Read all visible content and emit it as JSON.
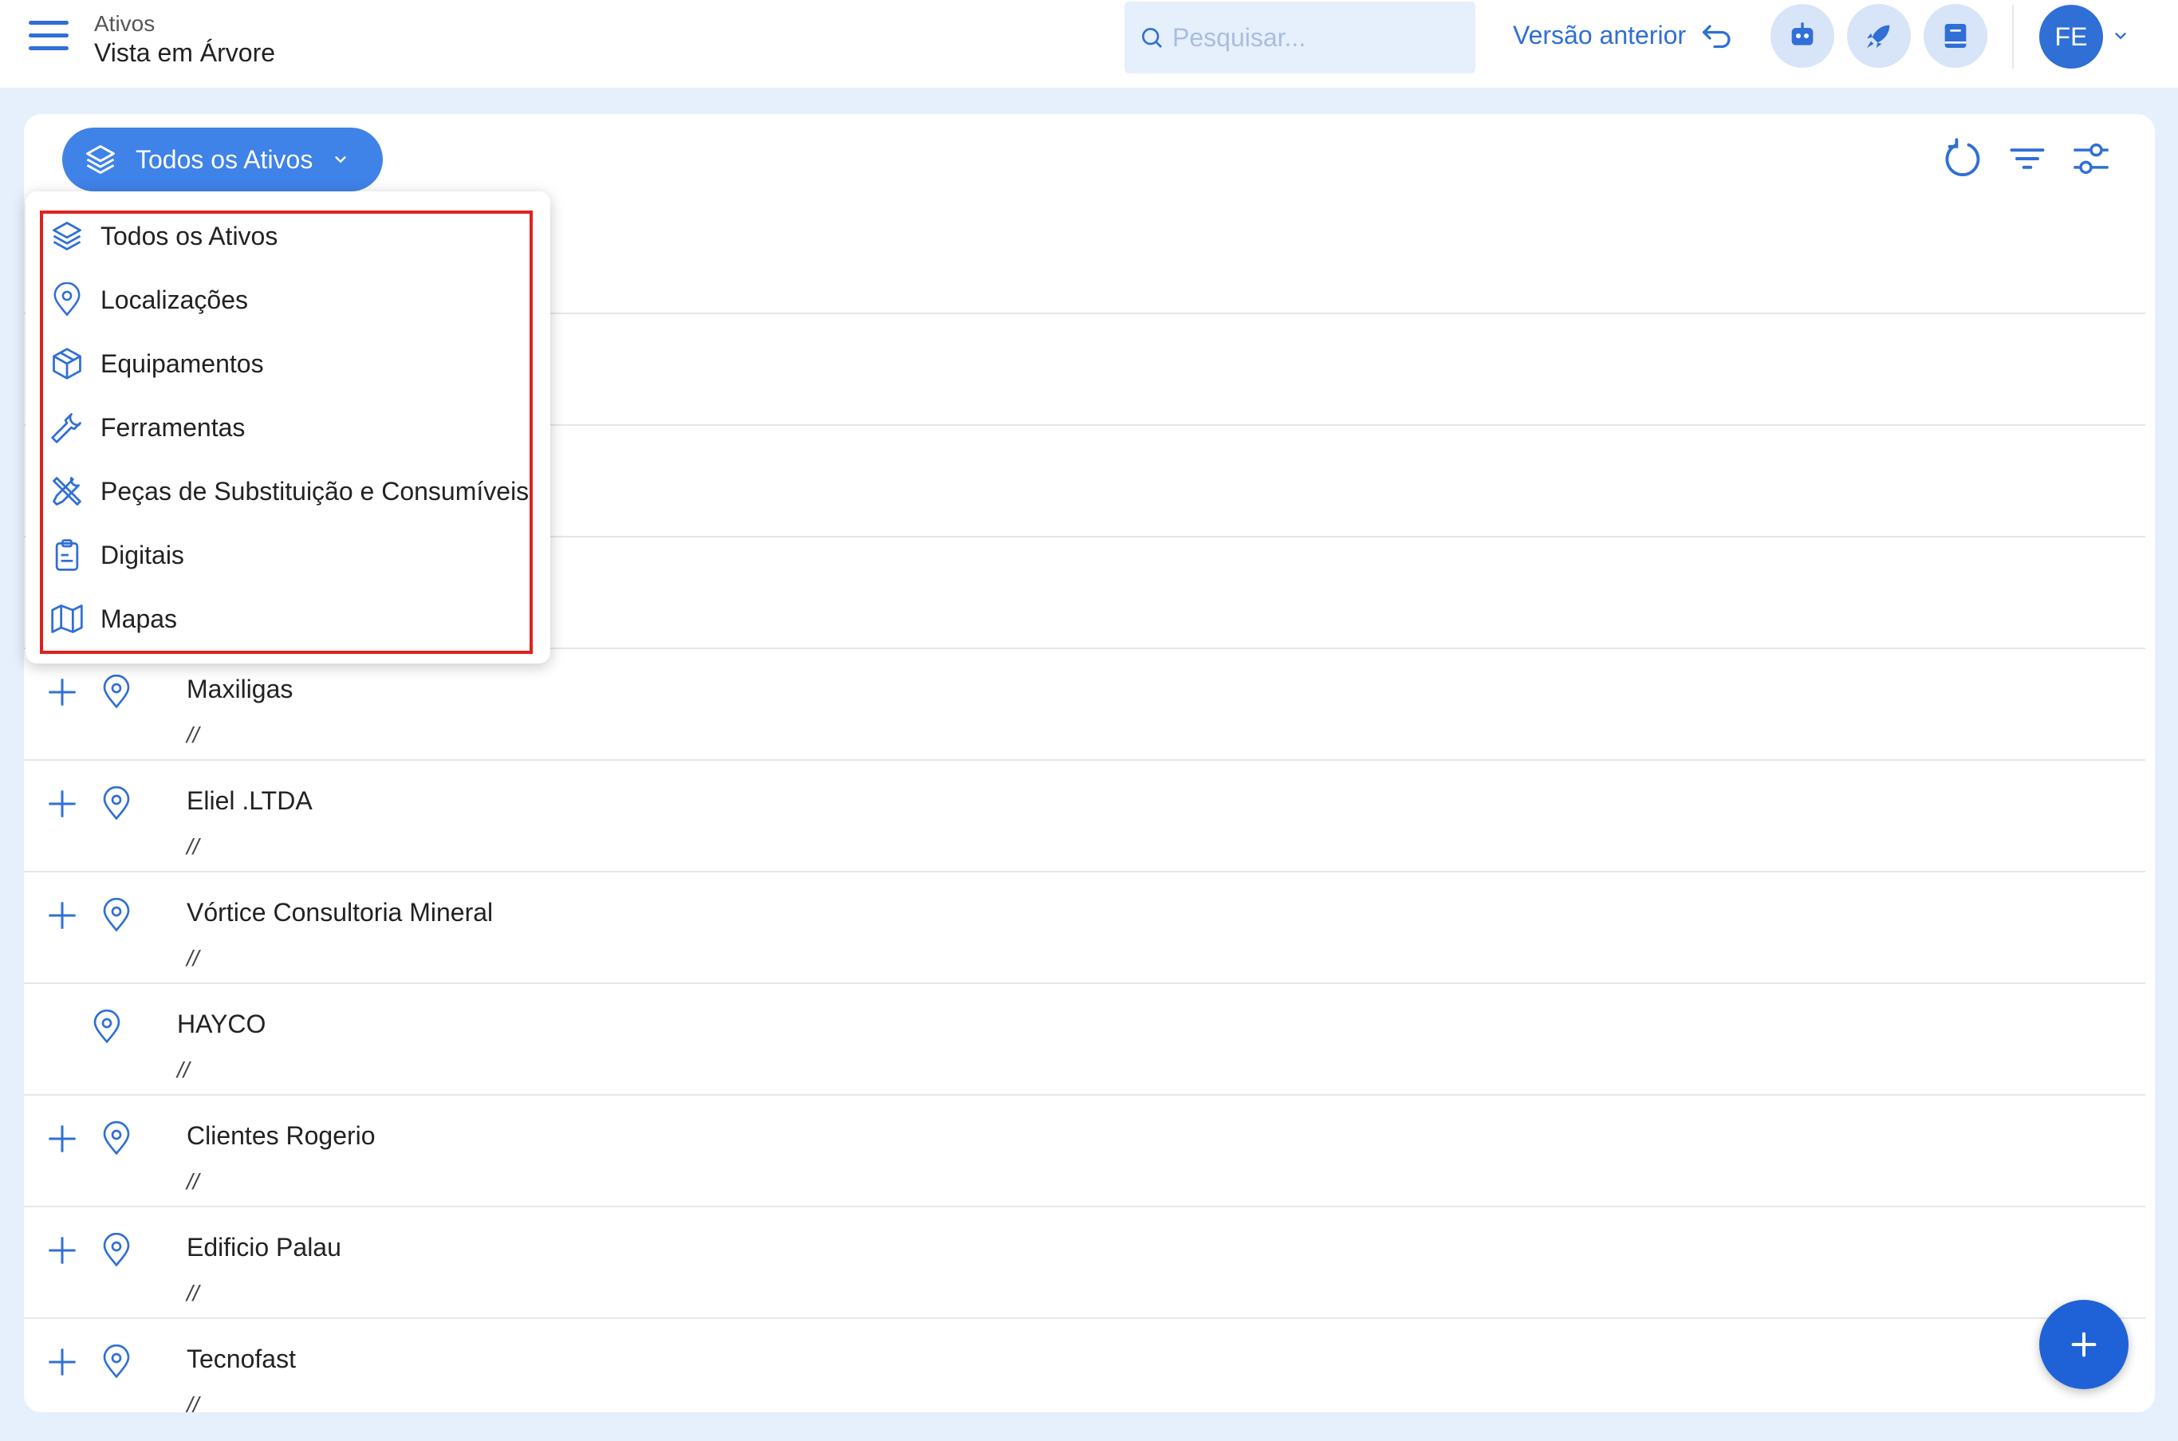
{
  "header": {
    "breadcrumb_parent": "Ativos",
    "page_title": "Vista em Árvore",
    "search_placeholder": "Pesquisar...",
    "previous_version_label": "Versão anterior",
    "user_initials": "FE",
    "icons": [
      "menu-icon",
      "search-icon",
      "undo-arrow-icon",
      "robot-icon",
      "rocket-icon",
      "book-icon",
      "chevron-down-icon"
    ]
  },
  "toolbar": {
    "asset_type_label": "Todos os Ativos",
    "icons": [
      "refresh-icon",
      "filter-icon",
      "settings-sliders-icon"
    ]
  },
  "dropdown": {
    "items": [
      {
        "label": "Todos os Ativos",
        "icon": "layers-icon"
      },
      {
        "label": "Localizações",
        "icon": "location-pin-icon"
      },
      {
        "label": "Equipamentos",
        "icon": "box-icon"
      },
      {
        "label": "Ferramentas",
        "icon": "wrench-icon"
      },
      {
        "label": "Peças de Substituição e Consumíveis",
        "icon": "tools-crossed-icon"
      },
      {
        "label": "Digitais",
        "icon": "clipboard-icon"
      },
      {
        "label": "Mapas",
        "icon": "map-icon"
      }
    ]
  },
  "tree": {
    "rows": [
      {
        "name": "Maxiligas",
        "path": "//",
        "expandable": true
      },
      {
        "name": "Eliel .LTDA",
        "path": "//",
        "expandable": true
      },
      {
        "name": "Vórtice Consultoria Mineral",
        "path": "//",
        "expandable": true
      },
      {
        "name": "HAYCO",
        "path": "//",
        "expandable": false
      },
      {
        "name": "Clientes Rogerio",
        "path": "//",
        "expandable": true
      },
      {
        "name": "Edificio Palau",
        "path": "//",
        "expandable": true
      },
      {
        "name": "Tecnofast",
        "path": "//",
        "expandable": true
      }
    ]
  },
  "colors": {
    "accent": "#3f82e8",
    "fab": "#1f62d8",
    "highlight_border": "#e02020",
    "page_background": "#e6effc"
  }
}
